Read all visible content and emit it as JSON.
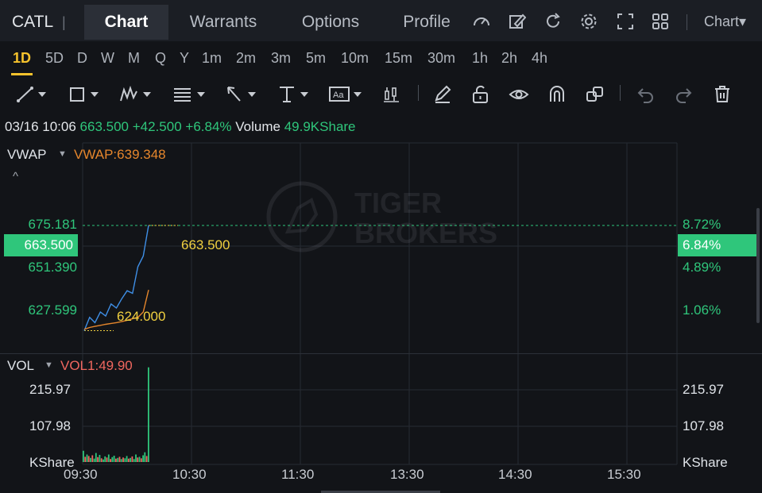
{
  "header": {
    "ticker": "CATL",
    "tabs": [
      "Chart",
      "Warrants",
      "Options",
      "Profile"
    ],
    "chart_menu": "Chart▾",
    "icons": [
      "speed-icon",
      "edit-icon",
      "refresh-icon",
      "settings-icon",
      "fullscreen-icon",
      "grid-icon"
    ]
  },
  "intervals": [
    "1D",
    "5D",
    "D",
    "W",
    "M",
    "Q",
    "Y",
    "1m",
    "2m",
    "3m",
    "5m",
    "10m",
    "15m",
    "30m",
    "1h",
    "2h",
    "4h"
  ],
  "toolbar": [
    "line-tool-icon",
    "rect-tool-icon",
    "pattern-tool-icon",
    "fib-tool-icon",
    "arrow-tool-icon",
    "measure-tool-icon",
    "text-tool-icon",
    "candle-tool-icon",
    "pencil-icon",
    "unlock-icon",
    "eye-icon",
    "magnet-icon",
    "link-icon",
    "undo-icon",
    "redo-icon",
    "trash-icon"
  ],
  "info": {
    "datetime": "03/16 10:06",
    "price": "663.500",
    "change": "+42.500",
    "change_pct": "+6.84%",
    "volume_label": "Volume",
    "volume": "49.9KShare"
  },
  "main_indicator": {
    "name": "VWAP",
    "value": "VWAP:639.348",
    "collapse": "^"
  },
  "vol_indicator": {
    "name": "VOL",
    "value": "VOL1:49.90"
  },
  "watermark": {
    "line1": "TIGER",
    "line2": "BROKERS"
  },
  "colors": {
    "up": "#2fc67b",
    "down": "#f0675f",
    "price_line": "#3f8fe6",
    "vwap_line": "#e5862c",
    "highlight": "#f0d040"
  },
  "chart_data": [
    {
      "type": "line",
      "title": "",
      "x": [
        "09:30",
        "09:33",
        "09:36",
        "09:39",
        "09:42",
        "09:45",
        "09:48",
        "09:51",
        "09:54",
        "09:57",
        "10:00",
        "10:03",
        "10:06"
      ],
      "series": [
        {
          "name": "",
          "values": [
            624.0,
            629.0,
            627.0,
            631.0,
            629.5,
            634.0,
            632.5,
            636.0,
            639.0,
            638.0,
            648.0,
            652.0,
            663.5
          ]
        },
        {
          "name": "VWAP",
          "values": [
            624.5,
            625.2,
            625.6,
            626.0,
            626.4,
            626.7,
            627.0,
            627.4,
            627.9,
            628.5,
            629.0,
            631.0,
            639.3
          ]
        }
      ],
      "left_ticks": [
        "675.181",
        "663.500",
        "651.390",
        "627.599"
      ],
      "right_ticks": [
        "8.72%",
        "6.84%",
        "4.89%",
        "1.06%"
      ],
      "markers": {
        "high": "663.500",
        "low": "624.000"
      },
      "ylim": [
        617.0,
        690.0
      ]
    },
    {
      "type": "bar",
      "title": "",
      "categories": [
        "09:30",
        "09:31",
        "09:32",
        "09:33",
        "09:34",
        "09:35",
        "09:36",
        "09:37",
        "09:38",
        "09:39",
        "09:40",
        "09:41",
        "09:42",
        "09:43",
        "09:44",
        "09:45",
        "09:46",
        "09:47",
        "09:48",
        "09:49",
        "09:50",
        "09:51",
        "09:52",
        "09:53",
        "09:54",
        "09:55",
        "09:56",
        "09:57",
        "09:58",
        "09:59",
        "10:00",
        "10:01",
        "10:02",
        "10:03",
        "10:04",
        "10:05",
        "10:06"
      ],
      "values": [
        30,
        14,
        20,
        16,
        11,
        18,
        9,
        24,
        13,
        19,
        10,
        7,
        15,
        12,
        20,
        8,
        13,
        17,
        9,
        11,
        14,
        8,
        12,
        10,
        16,
        9,
        11,
        15,
        8,
        20,
        12,
        14,
        10,
        18,
        26,
        16,
        252
      ],
      "up": [
        true,
        false,
        true,
        false,
        true,
        false,
        true,
        true,
        false,
        true,
        false,
        true,
        true,
        false,
        true,
        false,
        true,
        true,
        false,
        true,
        false,
        true,
        false,
        true,
        true,
        false,
        true,
        false,
        true,
        true,
        false,
        true,
        false,
        true,
        true,
        false,
        true
      ],
      "ticks": [
        "215.97",
        "107.98"
      ],
      "unit": "KShare",
      "ylim": [
        0,
        262
      ]
    }
  ],
  "time_axis": [
    "09:30",
    "10:30",
    "11:30",
    "13:30",
    "14:30",
    "15:30"
  ]
}
